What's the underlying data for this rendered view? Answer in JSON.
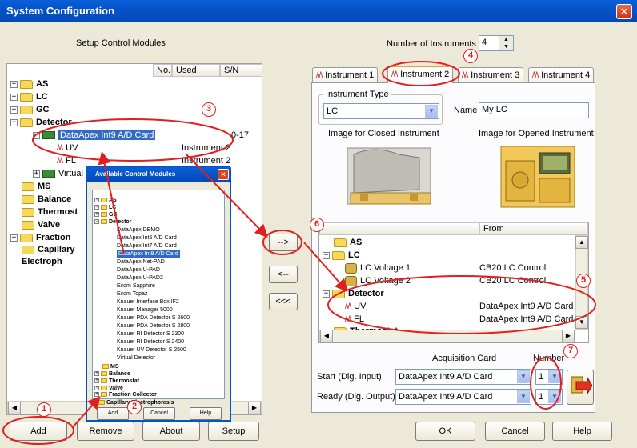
{
  "window": {
    "title": "System Configuration",
    "close_label": "✕"
  },
  "left": {
    "section_label": "Setup Control Modules",
    "columns": [
      "No.",
      "Used",
      "S/N"
    ],
    "tree": [
      {
        "label": "AS",
        "used": "",
        "sn": ""
      },
      {
        "label": "LC",
        "used": "",
        "sn": ""
      },
      {
        "label": "GC",
        "used": "",
        "sn": ""
      },
      {
        "label": "Detector",
        "used": "",
        "sn": ""
      },
      {
        "label": "DataApex Int9 A/D Card",
        "used": "",
        "sn": "0-17"
      },
      {
        "label": "UV",
        "used": "Instrument 2",
        "sn": ""
      },
      {
        "label": "FL",
        "used": "Instrument 2",
        "sn": ""
      },
      {
        "label": "Virtual",
        "used": "",
        "sn": ""
      },
      {
        "label": "MS",
        "used": "",
        "sn": ""
      },
      {
        "label": "Balance",
        "used": "",
        "sn": ""
      },
      {
        "label": "Thermost",
        "used": "",
        "sn": ""
      },
      {
        "label": "Valve",
        "used": "",
        "sn": ""
      },
      {
        "label": "Fraction",
        "used": "",
        "sn": ""
      },
      {
        "label": "Capillary Electroph",
        "used": "",
        "sn": ""
      }
    ],
    "buttons": {
      "add": "Add",
      "remove": "Remove",
      "about": "About",
      "setup": "Setup"
    }
  },
  "popup": {
    "title": "Available Control Modules",
    "items": [
      "AS",
      "LC",
      "GC",
      "Detector",
      "DataApex DEMO",
      "DataApex Int5 A/D Card",
      "DataApex Int7 A/D Card",
      "DataApex Int9 A/D Card",
      "DataApex Net-PAD",
      "DataApex U-PAD",
      "DataApex U-PAD2",
      "Ecom Sapphire",
      "Ecom Topaz",
      "Knauer Interface Box IF2",
      "Knauer Manager 5000",
      "Knauer PDA Detector S 2600",
      "Knauer PDA Detector S 2800",
      "Knauer RI Detector S 2300",
      "Knauer RI Detector S 2400",
      "Knauer UV Detector S 2500",
      "Virtual Detector",
      "MS",
      "Balance",
      "Thermostat",
      "Valve",
      "Fraction Collector",
      "Capillary Electrophoresis"
    ],
    "buttons": {
      "add": "Add",
      "cancel": "Cancel",
      "help": "Help"
    }
  },
  "middle": {
    "move_right": "-->",
    "move_left": "<--",
    "move_all_left": "<<<"
  },
  "right": {
    "num_instruments_label": "Number of Instruments",
    "num_instruments_value": "4",
    "tabs": [
      "Instrument 1",
      "Instrument 2",
      "Instrument 3",
      "Instrument 4"
    ],
    "instrument_type_label": "Instrument Type",
    "instrument_type_value": "LC",
    "name_label": "Name",
    "name_value": "My LC",
    "image_closed_label": "Image for Closed Instrument",
    "image_opened_label": "Image for Opened Instrument",
    "list_from_header": "From",
    "list": [
      {
        "label": "AS",
        "from": ""
      },
      {
        "label": "LC",
        "from": ""
      },
      {
        "label": "LC Voltage 1",
        "from": "CB20 LC Control"
      },
      {
        "label": "LC Voltage 2",
        "from": "CB20 LC Control"
      },
      {
        "label": "Detector",
        "from": ""
      },
      {
        "label": "UV",
        "from": "DataApex Int9 A/D Card"
      },
      {
        "label": "FL",
        "from": "DataApex Int9 A/D Card"
      },
      {
        "label": "Thermostat",
        "from": ""
      }
    ],
    "acq_card_label": "Acquisition Card",
    "number_label": "Number",
    "start_label": "Start (Dig. Input)",
    "start_card": "DataApex Int9 A/D Card",
    "start_number": "1",
    "ready_label": "Ready (Dig. Output)",
    "ready_card": "DataApex Int9 A/D Card",
    "ready_number": "1"
  },
  "footer": {
    "ok": "OK",
    "cancel": "Cancel",
    "help": "Help"
  },
  "annotations": [
    "1",
    "2",
    "3",
    "4",
    "5",
    "6",
    "7"
  ],
  "colors": {
    "annotation": "#e02020",
    "titlebar": "#0454c9",
    "selection": "#316ac5"
  }
}
